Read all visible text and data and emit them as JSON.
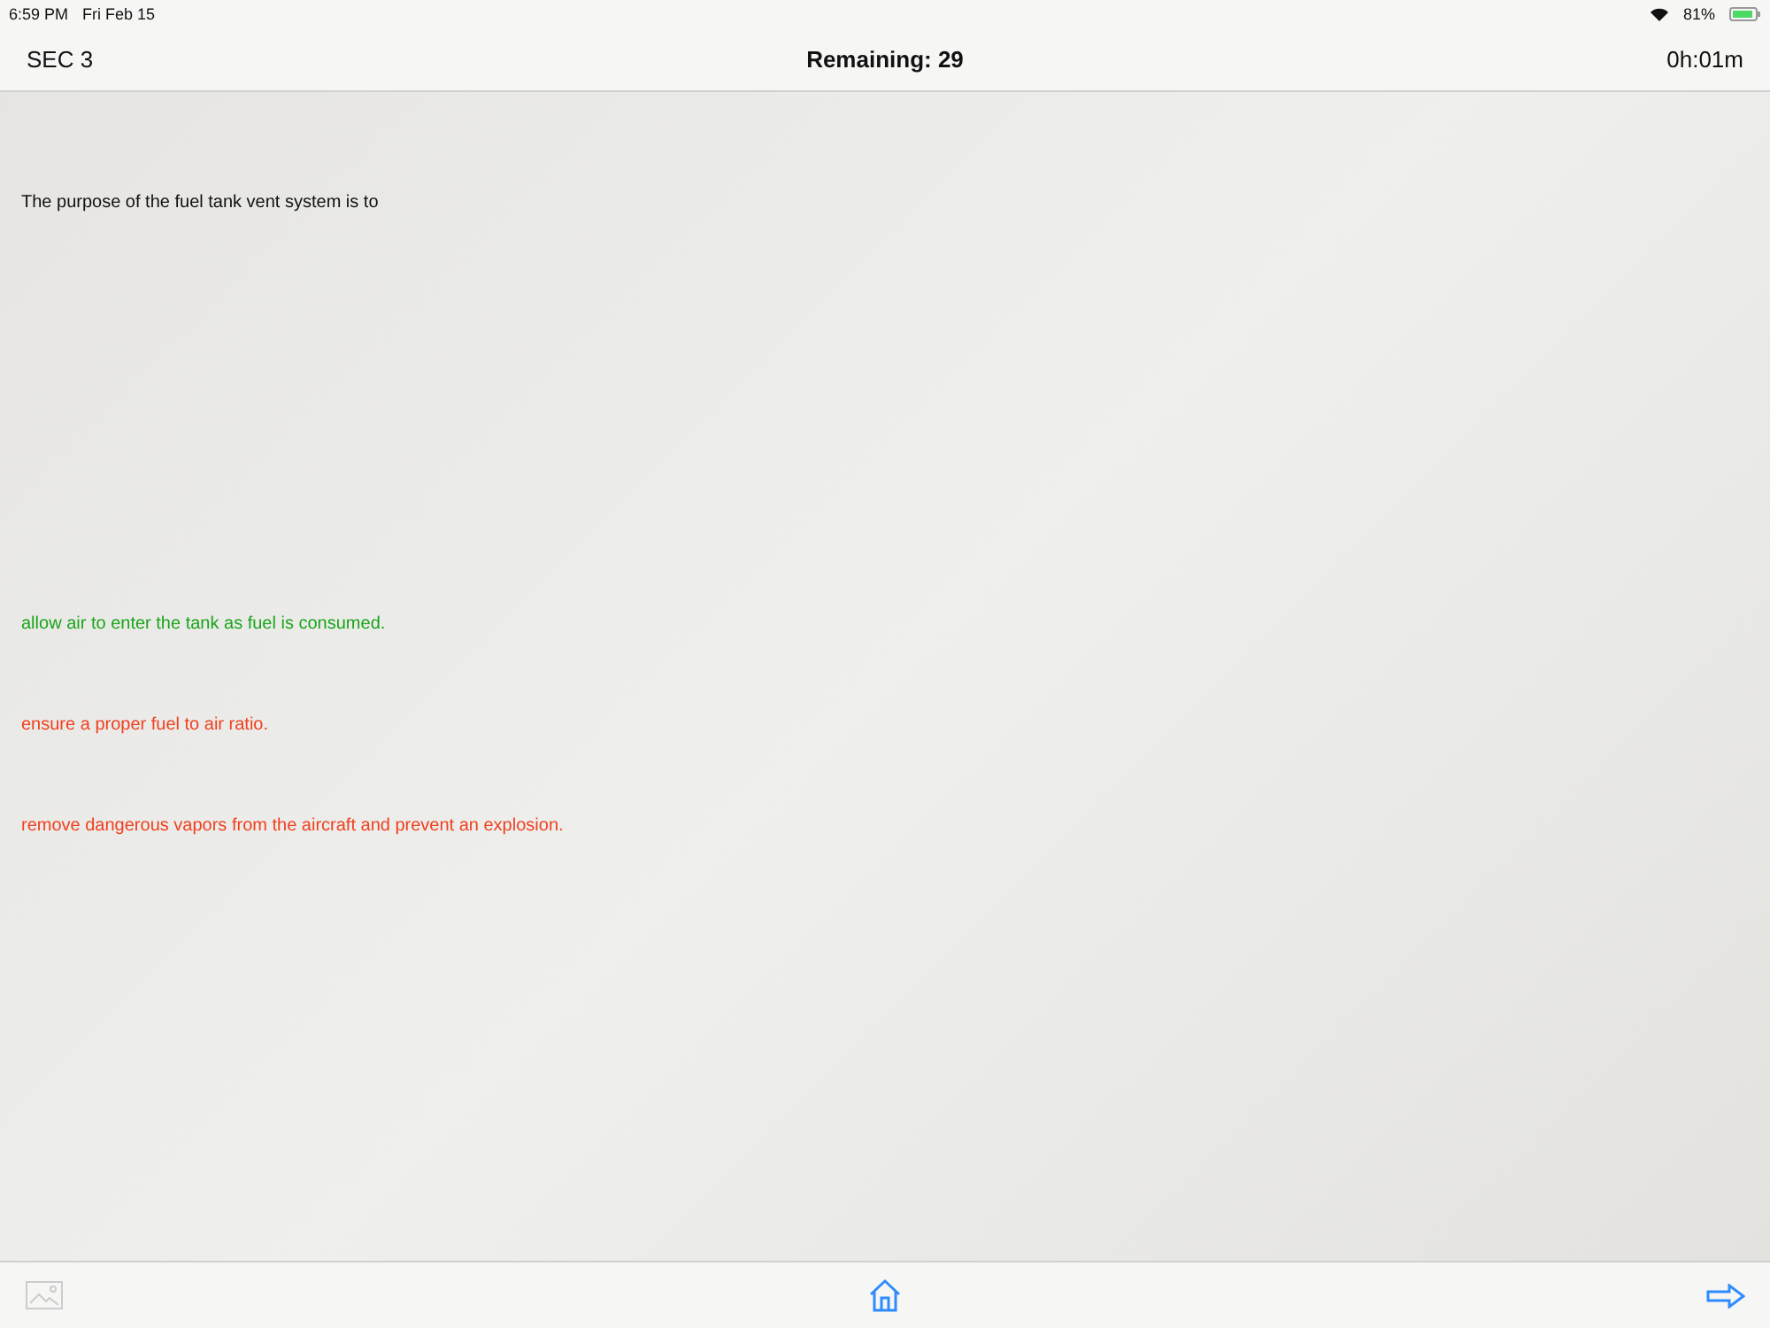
{
  "status_bar": {
    "time": "6:59 PM",
    "date": "Fri Feb 15",
    "battery": "81%"
  },
  "nav": {
    "section": "SEC 3",
    "remaining": "Remaining: 29",
    "timer": "0h:01m"
  },
  "question": "The purpose of the fuel tank vent system is to",
  "answers": [
    {
      "text": "allow air to enter the tank as fuel is consumed.",
      "correct": true
    },
    {
      "text": "ensure a proper fuel to air ratio.",
      "correct": false
    },
    {
      "text": "remove dangerous vapors from the aircraft and prevent an explosion.",
      "correct": false
    }
  ],
  "toolbar": {
    "image_disabled": true
  }
}
